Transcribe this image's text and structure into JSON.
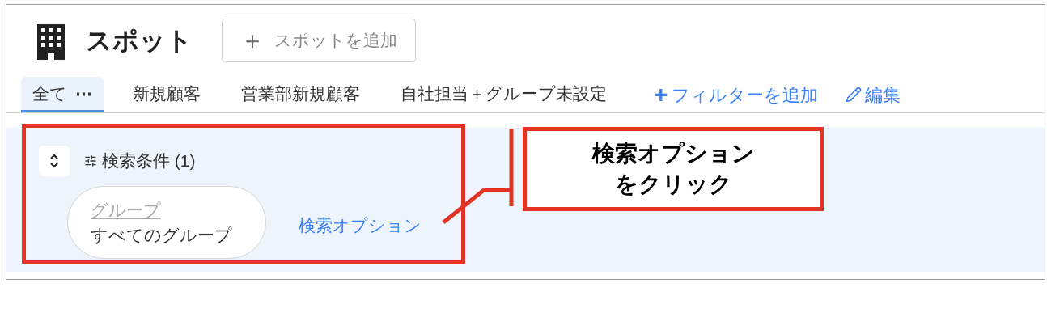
{
  "header": {
    "title": "スポット",
    "add_button": {
      "icon": "＋",
      "label": "スポットを追加"
    }
  },
  "tabs": [
    {
      "label": "全て",
      "menu": "⋯",
      "selected": true
    },
    {
      "label": "新規顧客",
      "selected": false
    },
    {
      "label": "営業部新規顧客",
      "selected": false
    },
    {
      "label": "自社担当＋グループ未設定",
      "selected": false
    }
  ],
  "tab_actions": [
    {
      "kind": "add",
      "icon": "+",
      "label": "フィルターを追加"
    },
    {
      "kind": "edit",
      "label": "編集"
    }
  ],
  "filter_panel": {
    "expanded": true,
    "title": "検索条件 (1)",
    "chips": [
      {
        "label": "グループ",
        "value": "すべてのグループ"
      }
    ],
    "options_link": "検索オプション"
  },
  "annotation": {
    "lines": [
      "検索オプション",
      "をクリック"
    ]
  }
}
